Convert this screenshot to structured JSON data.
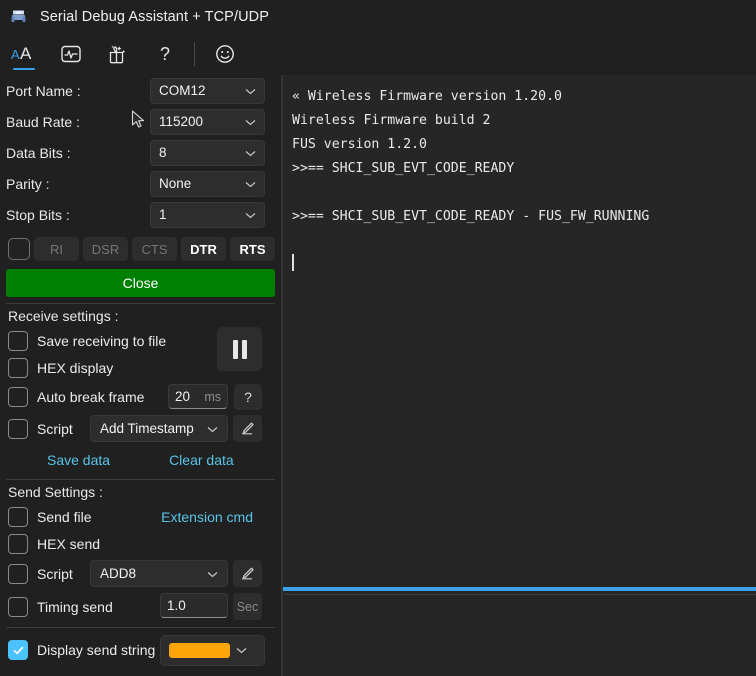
{
  "window": {
    "title": "Serial Debug Assistant + TCP/UDP",
    "icon": "serial-port-icon"
  },
  "toolbar": {
    "buttons": [
      {
        "name": "font-size-icon",
        "label": "AA",
        "active": true
      },
      {
        "name": "waveform-icon",
        "label": "Waveform"
      },
      {
        "name": "magic-gift-icon",
        "label": "Plugins"
      },
      {
        "name": "help-icon",
        "label": "?"
      },
      {
        "name": "smiley-icon",
        "label": "Feedback"
      }
    ]
  },
  "port_config": {
    "rows": [
      {
        "label": "Port Name :",
        "value": "COM12"
      },
      {
        "label": "Baud Rate :",
        "value": "115200"
      },
      {
        "label": "Data Bits :",
        "value": "8"
      },
      {
        "label": "Parity :",
        "value": "None"
      },
      {
        "label": "Stop Bits :",
        "value": "1"
      }
    ]
  },
  "signals": {
    "checkbox_checked": false,
    "buttons": [
      {
        "label": "RI",
        "active": false
      },
      {
        "label": "DSR",
        "active": false
      },
      {
        "label": "CTS",
        "active": false
      },
      {
        "label": "DTR",
        "active": true
      },
      {
        "label": "RTS",
        "active": true
      }
    ]
  },
  "connection": {
    "button_label": "Close",
    "button_color": "#008000"
  },
  "receive": {
    "title": "Receive settings :",
    "save_to_file": {
      "label": "Save receiving to file",
      "checked": false
    },
    "hex_display": {
      "label": "HEX display",
      "checked": false
    },
    "auto_break": {
      "label": "Auto break frame",
      "checked": false,
      "value": "20",
      "unit": "ms",
      "help": "?"
    },
    "script": {
      "label": "Script",
      "value": "Add Timestamp"
    },
    "pause_button": "pause-icon",
    "save_data_link": "Save data",
    "clear_data_link": "Clear data"
  },
  "send": {
    "title": "Send Settings :",
    "send_file": {
      "label": "Send file",
      "checked": false
    },
    "extension_cmd": "Extension cmd",
    "hex_send": {
      "label": "HEX send",
      "checked": false
    },
    "script": {
      "label": "Script",
      "value": "ADD8"
    },
    "timing_send": {
      "label": "Timing send",
      "checked": false,
      "value": "1.0",
      "unit": "Sec"
    },
    "display_send_string": {
      "label": "Display send string",
      "checked": true,
      "color": "#FFA50A"
    }
  },
  "terminal": {
    "lines": [
      "« Wireless Firmware version 1.20.0",
      "Wireless Firmware build 2",
      "FUS version 1.2.0",
      ">>== SHCI_SUB_EVT_CODE_READY",
      "",
      ">>== SHCI_SUB_EVT_CODE_READY - FUS_FW_RUNNING",
      ""
    ],
    "accent_line_color": "#3aa0e8",
    "send_input_value": ""
  }
}
